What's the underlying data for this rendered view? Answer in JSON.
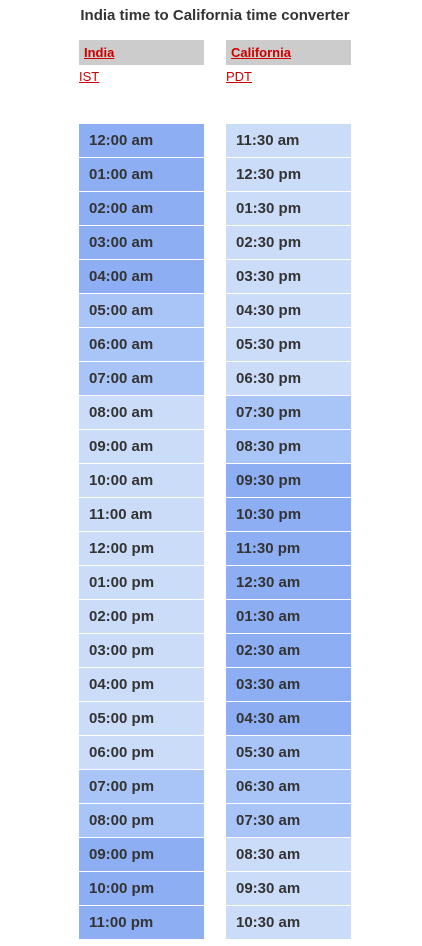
{
  "title": "India time to California time converter",
  "left": {
    "header": "India",
    "tz": "IST",
    "rows": [
      {
        "time": "12:00 am",
        "shade": "dark"
      },
      {
        "time": "01:00 am",
        "shade": "dark"
      },
      {
        "time": "02:00 am",
        "shade": "dark"
      },
      {
        "time": "03:00 am",
        "shade": "dark"
      },
      {
        "time": "04:00 am",
        "shade": "dark"
      },
      {
        "time": "05:00 am",
        "shade": "mid"
      },
      {
        "time": "06:00 am",
        "shade": "mid"
      },
      {
        "time": "07:00 am",
        "shade": "mid"
      },
      {
        "time": "08:00 am",
        "shade": "light"
      },
      {
        "time": "09:00 am",
        "shade": "light"
      },
      {
        "time": "10:00 am",
        "shade": "light"
      },
      {
        "time": "11:00 am",
        "shade": "light"
      },
      {
        "time": "12:00 pm",
        "shade": "light"
      },
      {
        "time": "01:00 pm",
        "shade": "light"
      },
      {
        "time": "02:00 pm",
        "shade": "light"
      },
      {
        "time": "03:00 pm",
        "shade": "light"
      },
      {
        "time": "04:00 pm",
        "shade": "light"
      },
      {
        "time": "05:00 pm",
        "shade": "light"
      },
      {
        "time": "06:00 pm",
        "shade": "light"
      },
      {
        "time": "07:00 pm",
        "shade": "mid"
      },
      {
        "time": "08:00 pm",
        "shade": "mid"
      },
      {
        "time": "09:00 pm",
        "shade": "dark"
      },
      {
        "time": "10:00 pm",
        "shade": "dark"
      },
      {
        "time": "11:00 pm",
        "shade": "dark"
      }
    ]
  },
  "right": {
    "header": "California",
    "tz": "PDT",
    "rows": [
      {
        "time": "11:30 am",
        "shade": "light"
      },
      {
        "time": "12:30 pm",
        "shade": "light"
      },
      {
        "time": "01:30 pm",
        "shade": "light"
      },
      {
        "time": "02:30 pm",
        "shade": "light"
      },
      {
        "time": "03:30 pm",
        "shade": "light"
      },
      {
        "time": "04:30 pm",
        "shade": "light"
      },
      {
        "time": "05:30 pm",
        "shade": "light"
      },
      {
        "time": "06:30 pm",
        "shade": "light"
      },
      {
        "time": "07:30 pm",
        "shade": "mid"
      },
      {
        "time": "08:30 pm",
        "shade": "mid"
      },
      {
        "time": "09:30 pm",
        "shade": "dark"
      },
      {
        "time": "10:30 pm",
        "shade": "dark"
      },
      {
        "time": "11:30 pm",
        "shade": "dark"
      },
      {
        "time": "12:30 am",
        "shade": "dark"
      },
      {
        "time": "01:30 am",
        "shade": "dark"
      },
      {
        "time": "02:30 am",
        "shade": "dark"
      },
      {
        "time": "03:30 am",
        "shade": "dark"
      },
      {
        "time": "04:30 am",
        "shade": "dark"
      },
      {
        "time": "05:30 am",
        "shade": "mid"
      },
      {
        "time": "06:30 am",
        "shade": "mid"
      },
      {
        "time": "07:30 am",
        "shade": "mid"
      },
      {
        "time": "08:30 am",
        "shade": "light"
      },
      {
        "time": "09:30 am",
        "shade": "light"
      },
      {
        "time": "10:30 am",
        "shade": "light"
      }
    ]
  },
  "colors": {
    "dark": "#8daef3",
    "mid": "#a9c4f6",
    "light": "#cadcf8",
    "header_bg": "#cccccc",
    "link": "#cc0000"
  }
}
